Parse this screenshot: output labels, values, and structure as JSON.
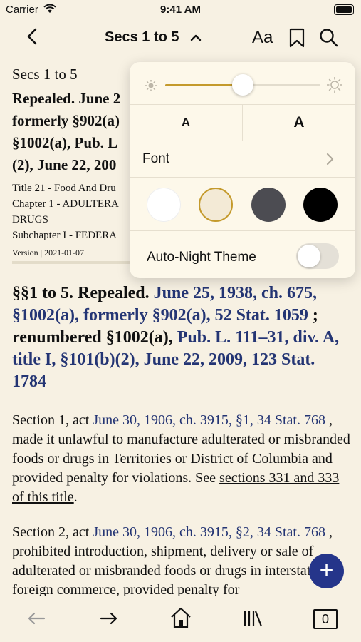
{
  "status": {
    "carrier": "Carrier",
    "time": "9:41 AM"
  },
  "nav": {
    "title": "Secs 1 to 5",
    "aa_label": "Aa"
  },
  "doc": {
    "header": "Secs 1 to 5",
    "title_lines": [
      "Repealed. June 2",
      "formerly §902(a)",
      "§1002(a), Pub. L",
      "(2), June 22, 200"
    ],
    "meta_lines": [
      "Title 21 - Food And Dru",
      "Chapter 1 - ADULTERA",
      "DRUGS",
      "Subchapter I - FEDERA"
    ],
    "version": "Version | 2021-01-07"
  },
  "heading": {
    "p1": "§§1 to 5. Repealed. ",
    "l1": "June 25, 1938, ch. 675, §1002(a), formerly §902(a), 52 Stat. 1059",
    "p2": " ; renumbered §1002(a), ",
    "l2": "Pub. L. 111–31, div. A, title I, §101(b)(2), June 22, 2009, 123 Stat. 1784"
  },
  "para1": {
    "t1": "Section 1, act ",
    "l1": "June 30, 1906, ch. 3915, §1, 34 Stat. 768",
    "t2": " , made it unlawful to manufacture adulterated or misbranded foods or drugs in Territories or District of Columbia and provided penalty for violations. See ",
    "u1": "sections 331 and 333 of this title",
    "t3": "."
  },
  "para2": {
    "t1": "Section 2, act ",
    "l1": "June 30, 1906, ch. 3915, §2, 34 Stat. 768",
    "t2": " , prohibited introduction, shipment, delivery or sale of adulterated or misbranded foods or drugs in interstate or foreign commerce, provided penalty for"
  },
  "popover": {
    "brightness": 0.5,
    "font_small": "A",
    "font_large": "A",
    "font_label": "Font",
    "themes": [
      {
        "name": "white",
        "color": "#ffffff",
        "selected": false
      },
      {
        "name": "sepia",
        "color": "#f3ead6",
        "selected": true
      },
      {
        "name": "gray",
        "color": "#4c4c52",
        "selected": false
      },
      {
        "name": "black",
        "color": "#000000",
        "selected": false
      }
    ],
    "auto_night_label": "Auto-Night Theme",
    "auto_night_on": false
  },
  "colors": {
    "accent": "#c49a2c",
    "link": "#243574",
    "fab": "#25358a",
    "background": "#f7f1e3"
  },
  "tabbar": {
    "count": "0"
  }
}
